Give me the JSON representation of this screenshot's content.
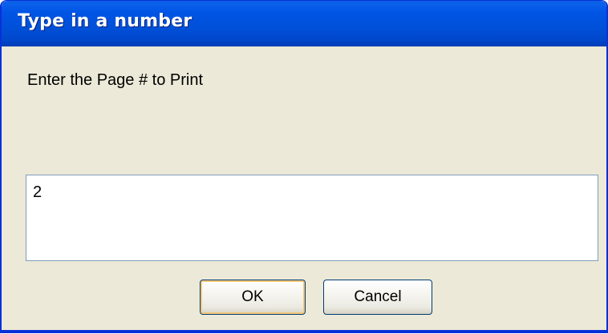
{
  "window": {
    "title": "Type in a number"
  },
  "prompt": {
    "label": "Enter the Page # to Print"
  },
  "input": {
    "value": "2"
  },
  "buttons": {
    "ok_label": "OK",
    "cancel_label": "Cancel"
  },
  "colors": {
    "titlebar": "#0055E5",
    "dialog_background": "#ECE9D8",
    "input_border": "#7F9DB9",
    "button_border": "#003C74"
  }
}
